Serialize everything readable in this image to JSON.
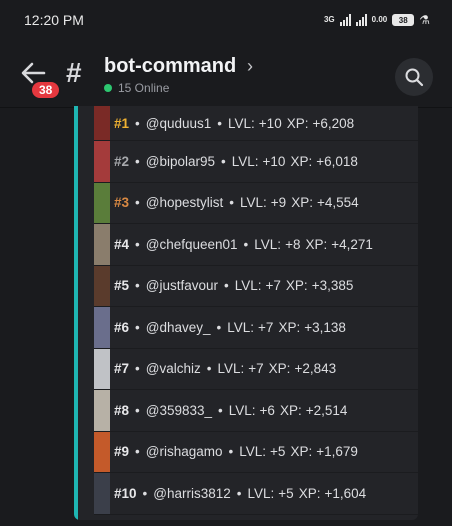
{
  "status": {
    "time": "12:20 PM",
    "network": "3G",
    "data_speed": "0.00",
    "battery": "38"
  },
  "header": {
    "badge_count": "38",
    "channel_name": "bot-command",
    "online": "15 Online"
  },
  "leaderboard": [
    {
      "rank": "#1",
      "handle": "@quduus1",
      "lvl": "+10",
      "xp": "+6,208"
    },
    {
      "rank": "#2",
      "handle": "@bipolar95",
      "lvl": "+10",
      "xp": "+6,018"
    },
    {
      "rank": "#3",
      "handle": "@hopestylist",
      "lvl": "+9",
      "xp": "+4,554"
    },
    {
      "rank": "#4",
      "handle": "@chefqueen01",
      "lvl": "+8",
      "xp": "+4,271"
    },
    {
      "rank": "#5",
      "handle": "@justfavour",
      "lvl": "+7",
      "xp": "+3,385"
    },
    {
      "rank": "#6",
      "handle": "@dhavey_",
      "lvl": "+7",
      "xp": "+3,138"
    },
    {
      "rank": "#7",
      "handle": "@valchiz",
      "lvl": "+7",
      "xp": "+2,843"
    },
    {
      "rank": "#8",
      "handle": "@359833_",
      "lvl": "+6",
      "xp": "+2,514"
    },
    {
      "rank": "#9",
      "handle": "@rishagamo",
      "lvl": "+5",
      "xp": "+1,679"
    },
    {
      "rank": "#10",
      "handle": "@harris3812",
      "lvl": "+5",
      "xp": "+1,604"
    }
  ],
  "labels": {
    "separator": "•",
    "lvl": "LVL:",
    "xp": "XP:"
  },
  "colors": {
    "embed_accent": "#1fb6b3",
    "gold": "#f0b232",
    "silver": "#a7a9ad",
    "bronze": "#d98943",
    "online": "#2dc770",
    "badge": "#e5383f"
  },
  "icons": {
    "back": "arrow-left-icon",
    "channel": "hash-icon",
    "chevron": "chevron-right-icon",
    "search": "search-icon"
  }
}
